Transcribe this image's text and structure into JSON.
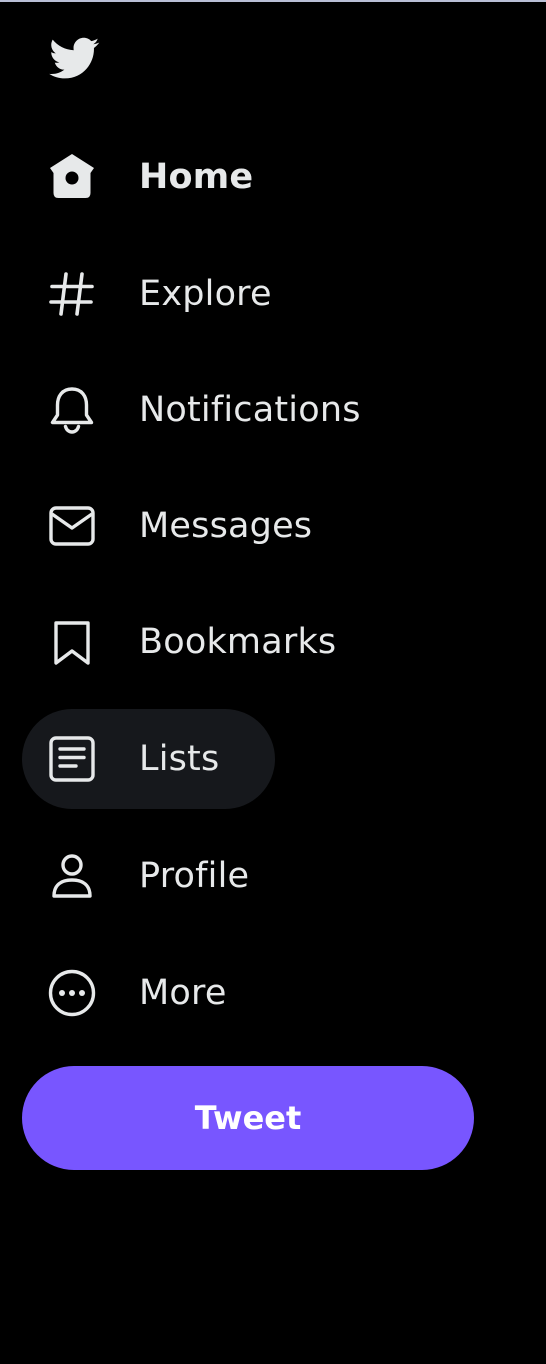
{
  "theme": {
    "background": "#000000",
    "text": "#e7e9ea",
    "accent": "#7856ff",
    "hover_background": "#16181c"
  },
  "logo": {
    "icon": "twitter-bird-icon"
  },
  "nav": {
    "items": [
      {
        "label": "Home",
        "icon": "home-icon",
        "active": true
      },
      {
        "label": "Explore",
        "icon": "hashtag-icon"
      },
      {
        "label": "Notifications",
        "icon": "bell-icon"
      },
      {
        "label": "Messages",
        "icon": "envelope-icon"
      },
      {
        "label": "Bookmarks",
        "icon": "bookmark-icon"
      },
      {
        "label": "Lists",
        "icon": "list-icon",
        "hovered": true
      },
      {
        "label": "Profile",
        "icon": "person-icon"
      },
      {
        "label": "More",
        "icon": "more-circle-icon"
      }
    ]
  },
  "tweet_button": {
    "label": "Tweet"
  }
}
